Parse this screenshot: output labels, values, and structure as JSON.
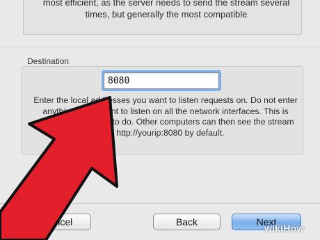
{
  "top_section": {
    "text": "most efficient, as the server needs to send the stream several times, but generally the most compatible"
  },
  "destination": {
    "label": "Destination",
    "port_value": "8080",
    "help_text": "Enter the local addresses you want to listen requests on. Do not enter anything if you want to listen on all the network interfaces. This is often the best thing to do. Other computers can then see the stream at http://yourip:8080 by default."
  },
  "buttons": {
    "cancel": "Cancel",
    "back": "Back",
    "next": "Next"
  },
  "overlay": {
    "arrow_color": "#e21f2b",
    "arrow_outline": "#111111"
  },
  "watermark": {
    "text": "wikiHow"
  }
}
